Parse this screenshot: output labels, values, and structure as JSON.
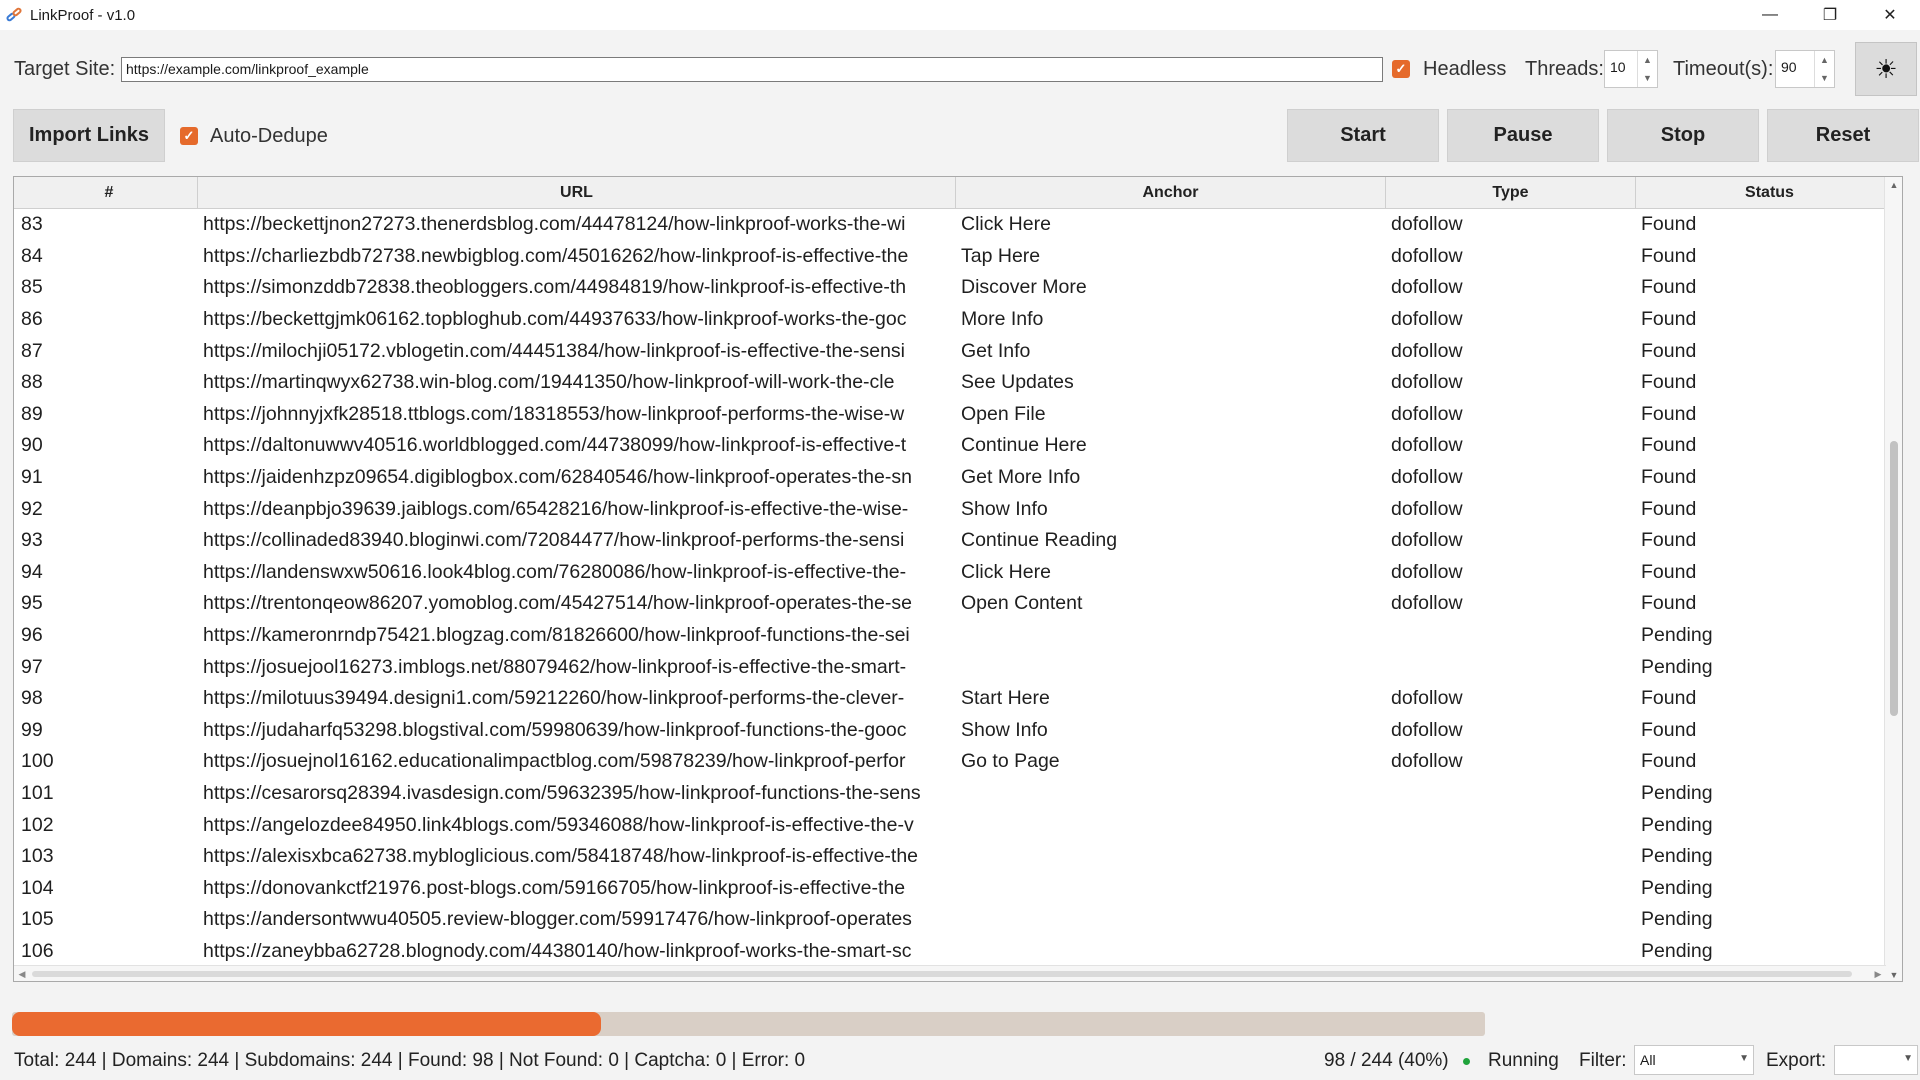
{
  "window": {
    "title": "LinkProof - v1.0",
    "minimize": "—",
    "maximize": "❐",
    "close": "✕"
  },
  "config": {
    "target_label": "Target Site:",
    "target_value": "https://example.com/linkproof_example",
    "headless_label": "Headless",
    "headless_checked": true,
    "threads_label": "Threads:",
    "threads_value": "10",
    "timeout_label": "Timeout(s):",
    "timeout_value": "90",
    "theme_icon": "☀"
  },
  "toolbar": {
    "import_label": "Import Links",
    "autodedupe_label": "Auto-Dedupe",
    "autodedupe_checked": true,
    "start_label": "Start",
    "pause_label": "Pause",
    "stop_label": "Stop",
    "reset_label": "Reset"
  },
  "table": {
    "columns": [
      "#",
      "URL",
      "Anchor",
      "Type",
      "Status"
    ],
    "rows": [
      [
        "83",
        "https://beckettjnon27273.thenerdsblog.com/44478124/how-linkproof-works-the-wi",
        "Click Here",
        "dofollow",
        "Found"
      ],
      [
        "84",
        "https://charliezbdb72738.newbigblog.com/45016262/how-linkproof-is-effective-the",
        "Tap Here",
        "dofollow",
        "Found"
      ],
      [
        "85",
        "https://simonzddb72838.theobloggers.com/44984819/how-linkproof-is-effective-th",
        "Discover More",
        "dofollow",
        "Found"
      ],
      [
        "86",
        "https://beckettgjmk06162.topbloghub.com/44937633/how-linkproof-works-the-goc",
        "More Info",
        "dofollow",
        "Found"
      ],
      [
        "87",
        "https://milochji05172.vblogetin.com/44451384/how-linkproof-is-effective-the-sensi",
        "Get Info",
        "dofollow",
        "Found"
      ],
      [
        "88",
        "https://martinqwyx62738.win-blog.com/19441350/how-linkproof-will-work-the-cle",
        "See Updates",
        "dofollow",
        "Found"
      ],
      [
        "89",
        "https://johnnyjxfk28518.ttblogs.com/18318553/how-linkproof-performs-the-wise-w",
        "Open File",
        "dofollow",
        "Found"
      ],
      [
        "90",
        "https://daltonuwwv40516.worldblogged.com/44738099/how-linkproof-is-effective-t",
        "Continue Here",
        "dofollow",
        "Found"
      ],
      [
        "91",
        "https://jaidenhzpz09654.digiblogbox.com/62840546/how-linkproof-operates-the-sn",
        "Get More Info",
        "dofollow",
        "Found"
      ],
      [
        "92",
        "https://deanpbjo39639.jaiblogs.com/65428216/how-linkproof-is-effective-the-wise-",
        "Show Info",
        "dofollow",
        "Found"
      ],
      [
        "93",
        "https://collinaded83940.bloginwi.com/72084477/how-linkproof-performs-the-sensi",
        "Continue Reading",
        "dofollow",
        "Found"
      ],
      [
        "94",
        "https://landenswxw50616.look4blog.com/76280086/how-linkproof-is-effective-the-",
        "Click Here",
        "dofollow",
        "Found"
      ],
      [
        "95",
        "https://trentonqeow86207.yomoblog.com/45427514/how-linkproof-operates-the-se",
        "Open Content",
        "dofollow",
        "Found"
      ],
      [
        "96",
        "https://kameronrndp75421.blogzag.com/81826600/how-linkproof-functions-the-sei",
        "",
        "",
        "Pending"
      ],
      [
        "97",
        "https://josuejool16273.imblogs.net/88079462/how-linkproof-is-effective-the-smart-",
        "",
        "",
        "Pending"
      ],
      [
        "98",
        "https://milotuus39494.designi1.com/59212260/how-linkproof-performs-the-clever-",
        "Start Here",
        "dofollow",
        "Found"
      ],
      [
        "99",
        "https://judaharfq53298.blogstival.com/59980639/how-linkproof-functions-the-gooc",
        "Show Info",
        "dofollow",
        "Found"
      ],
      [
        "100",
        "https://josuejnol16162.educationalimpactblog.com/59878239/how-linkproof-perfor",
        "Go to Page",
        "dofollow",
        "Found"
      ],
      [
        "101",
        "https://cesarorsq28394.ivasdesign.com/59632395/how-linkproof-functions-the-sens",
        "",
        "",
        "Pending"
      ],
      [
        "102",
        "https://angelozdee84950.link4blogs.com/59346088/how-linkproof-is-effective-the-v",
        "",
        "",
        "Pending"
      ],
      [
        "103",
        "https://alexisxbca62738.mybloglicious.com/58418748/how-linkproof-is-effective-the",
        "",
        "",
        "Pending"
      ],
      [
        "104",
        "https://donovankctf21976.post-blogs.com/59166705/how-linkproof-is-effective-the",
        "",
        "",
        "Pending"
      ],
      [
        "105",
        "https://andersontwwu40505.review-blogger.com/59917476/how-linkproof-operates",
        "",
        "",
        "Pending"
      ],
      [
        "106",
        "https://zaneybba62728.blognody.com/44380140/how-linkproof-works-the-smart-sc",
        "",
        "",
        "Pending"
      ]
    ]
  },
  "progress": {
    "done": 98,
    "total": 244,
    "fraction": 0.4
  },
  "status": {
    "summary": "Total: 244 | Domains: 244 | Subdomains: 244 | Found: 98 | Not Found: 0 | Captcha: 0 | Error: 0",
    "progress_text": "98 / 244 (40%)",
    "state": "Running",
    "state_color": "#1fa33b",
    "filter_label": "Filter:",
    "filter_value": "All",
    "export_label": "Export:",
    "export_value": ""
  },
  "colors": {
    "accent": "#ea6a30",
    "progress_track": "#d9cfc6",
    "button_bg": "#dcdcdc"
  }
}
